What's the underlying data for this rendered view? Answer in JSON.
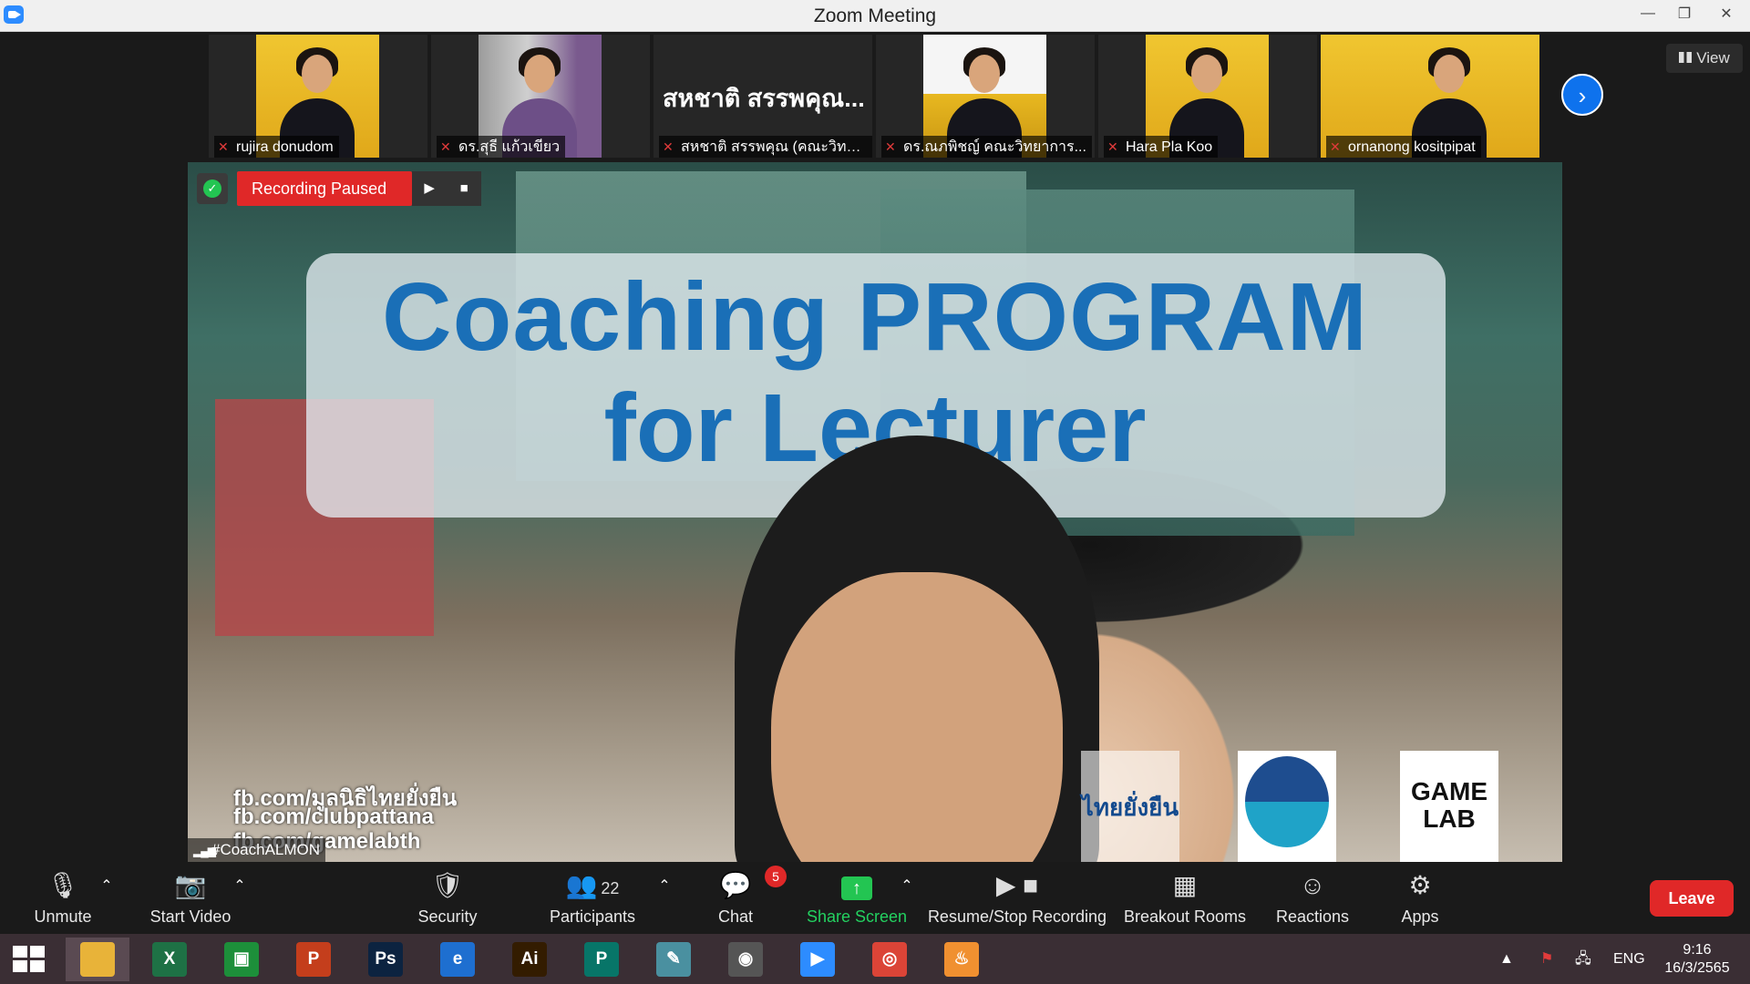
{
  "window": {
    "title": "Zoom Meeting",
    "minimize": "—",
    "restore": "❐",
    "close": "✕"
  },
  "participants_strip": {
    "tiles": [
      {
        "name": "rujira donudom"
      },
      {
        "name": "ดร.สุธี แก้วเขียว"
      },
      {
        "name": "สหชาติ สรรพคุณ (คณะวิทย์...",
        "display_name": "สหชาติ สรรพคุณ..."
      },
      {
        "name": "ดร.ณภพิชญ์ คณะวิทยาการ..."
      },
      {
        "name": "Hara Pla Koo"
      },
      {
        "name": "ornanong kositpipat"
      }
    ],
    "next_icon": "›",
    "view_label": "View"
  },
  "recording": {
    "status": "Recording Paused",
    "resume_icon": "▶",
    "stop_icon": "■",
    "shield_icon": "✓"
  },
  "shared_screen": {
    "heading_line1": "Coaching PROGRAM",
    "heading_line2": "for Lecturer",
    "links": [
      "fb.com/มูลนิธิไทยยั่งยืน",
      "fb.com/clubpattana",
      "fb.com/gamelabth"
    ],
    "logos": {
      "thai": "ไทยยั่งยืน",
      "game_line1": "GAME",
      "game_line2": "LAB"
    },
    "speaker_name": "#CoachALMON"
  },
  "toolbar": {
    "unmute": {
      "label": "Unmute",
      "icon": "🎙"
    },
    "start_video": {
      "label": "Start Video",
      "icon": "📷"
    },
    "security": {
      "label": "Security",
      "icon": "🛡"
    },
    "participants": {
      "label": "Participants",
      "count": "22",
      "icon": "👥"
    },
    "chat": {
      "label": "Chat",
      "badge": "5",
      "icon": "💬"
    },
    "share_screen": {
      "label": "Share Screen",
      "icon": "↑"
    },
    "recording": {
      "label": "Resume/Stop Recording",
      "icon": "▶ ■"
    },
    "breakout": {
      "label": "Breakout Rooms",
      "icon": "▦"
    },
    "reactions": {
      "label": "Reactions",
      "icon": "☺"
    },
    "apps": {
      "label": "Apps",
      "icon": "⚙"
    },
    "caret": "⌃",
    "leave": "Leave"
  },
  "taskbar": {
    "apps": [
      {
        "name": "file-explorer",
        "text": "",
        "color": "#e8b339"
      },
      {
        "name": "excel",
        "text": "X",
        "color": "#1e7145"
      },
      {
        "name": "store",
        "text": "▣",
        "color": "#1d8f3a"
      },
      {
        "name": "powerpoint",
        "text": "P",
        "color": "#c43e1c"
      },
      {
        "name": "photoshop",
        "text": "Ps",
        "color": "#0c2340"
      },
      {
        "name": "internet-explorer",
        "text": "e",
        "color": "#1e6fd0"
      },
      {
        "name": "illustrator",
        "text": "Ai",
        "color": "#331c00"
      },
      {
        "name": "publisher",
        "text": "P",
        "color": "#077568"
      },
      {
        "name": "notepad",
        "text": "✎",
        "color": "#4a90a0"
      },
      {
        "name": "photoscape",
        "text": "◉",
        "color": "#555555"
      },
      {
        "name": "zoom",
        "text": "▶",
        "color": "#2d8cff"
      },
      {
        "name": "chrome",
        "text": "◎",
        "color": "#db4437"
      },
      {
        "name": "paint",
        "text": "♨",
        "color": "#f09030"
      }
    ],
    "tray": {
      "arrow": "▲",
      "flag": "⚑",
      "network": "🖧",
      "lang": "ENG"
    },
    "time": "9:16",
    "date": "16/3/2565"
  },
  "colors": {
    "accent": "#2d8cff",
    "recording": "#e02828",
    "share": "#23c552"
  }
}
